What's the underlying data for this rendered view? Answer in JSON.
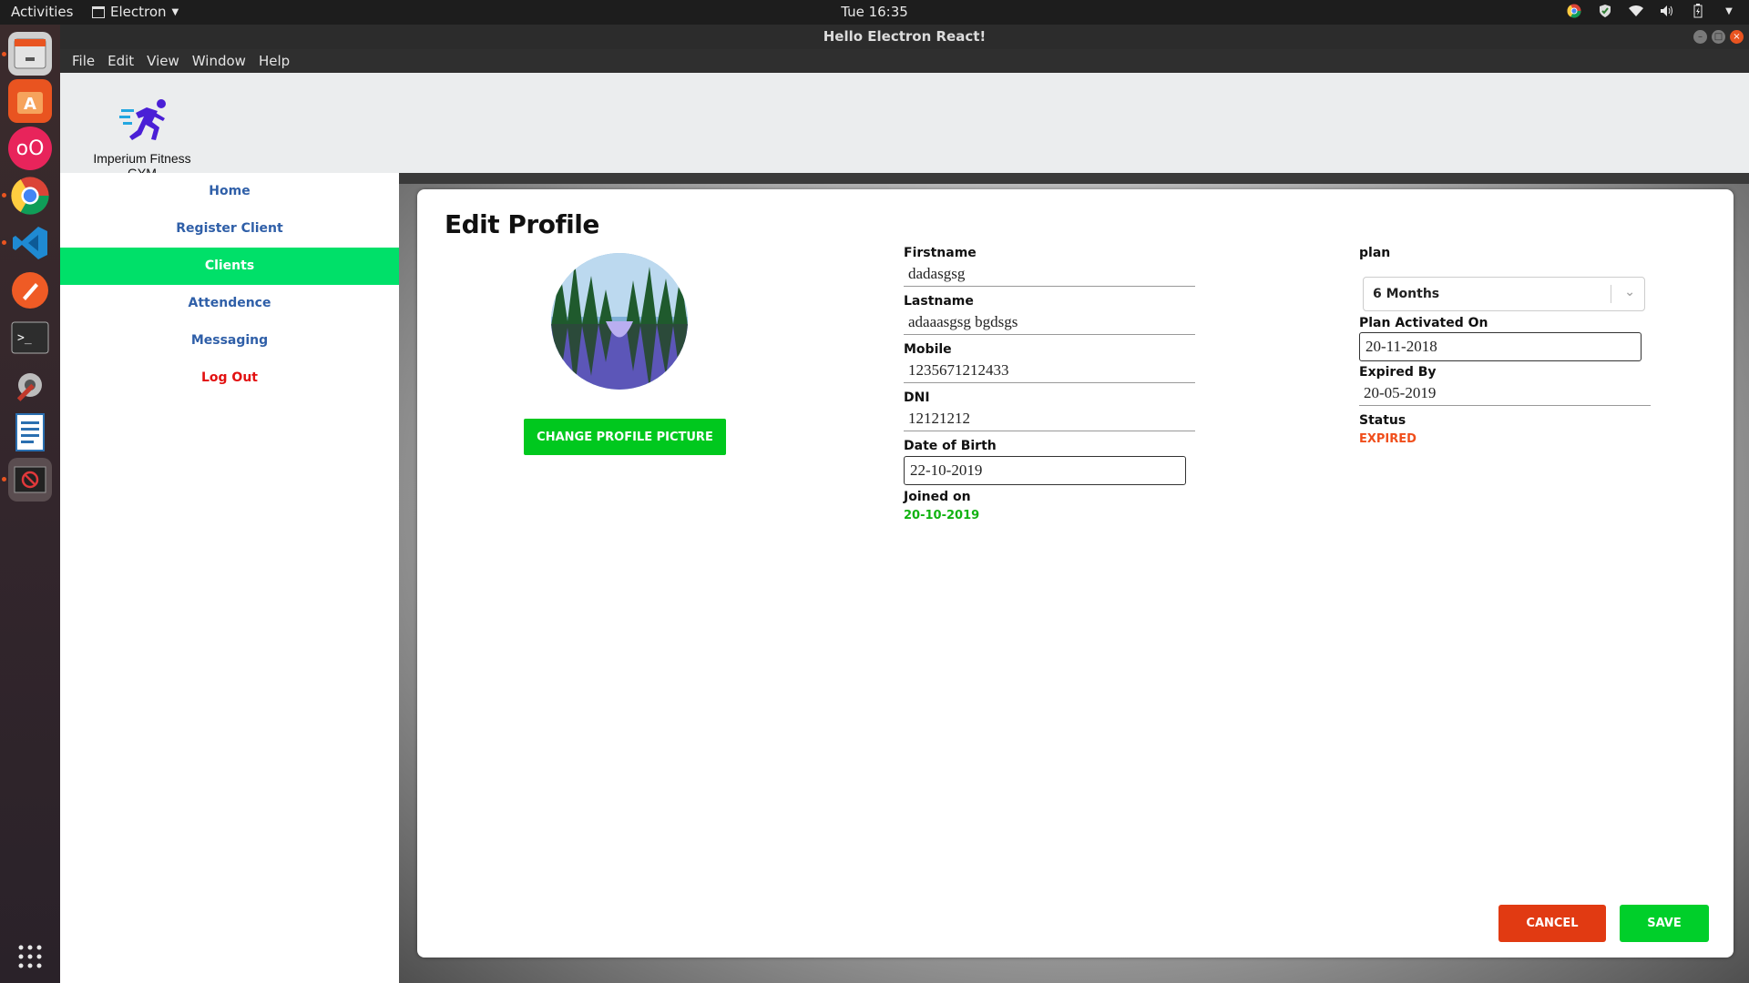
{
  "topbar": {
    "activities": "Activities",
    "app_menu": "Electron",
    "clock": "Tue 16:35"
  },
  "dock": {
    "icons": [
      "file-cabinet-icon",
      "software-center-icon",
      "daemon-icon",
      "chrome-icon",
      "vscode-icon",
      "postman-icon",
      "terminal-icon",
      "settings-tools-icon",
      "writer-document-icon",
      "blocked-app-icon",
      "app-grid-icon"
    ]
  },
  "window": {
    "title": "Hello Electron React!",
    "menu": [
      "File",
      "Edit",
      "View",
      "Window",
      "Help"
    ]
  },
  "app": {
    "brand": "Imperium Fitness GYM",
    "nav": {
      "home": "Home",
      "register": "Register Client",
      "clients": "Clients",
      "attendence": "Attendence",
      "messaging": "Messaging",
      "logout": "Log Out"
    },
    "accent": "#00e069"
  },
  "profile": {
    "title": "Edit Profile",
    "change_picture": "CHANGE PROFILE PICTURE",
    "firstname_label": "Firstname",
    "firstname": "dadasgsg",
    "lastname_label": "Lastname",
    "lastname": "adaaasgsg bgdsgs",
    "mobile_label": "Mobile",
    "mobile": "1235671212433",
    "dni_label": "DNI",
    "dni": "12121212",
    "dob_label": "Date of Birth",
    "dob": "22-10-2019",
    "joined_label": "Joined on",
    "joined": "20-10-2019",
    "plan_label": "plan",
    "plan": "6 Months",
    "plan_activated_label": "Plan Activated On",
    "plan_activated": "20-11-2018",
    "expired_label": "Expired By",
    "expired": "20-05-2019",
    "status_label": "Status",
    "status": "EXPIRED",
    "cancel": "CANCEL",
    "save": "SAVE"
  }
}
